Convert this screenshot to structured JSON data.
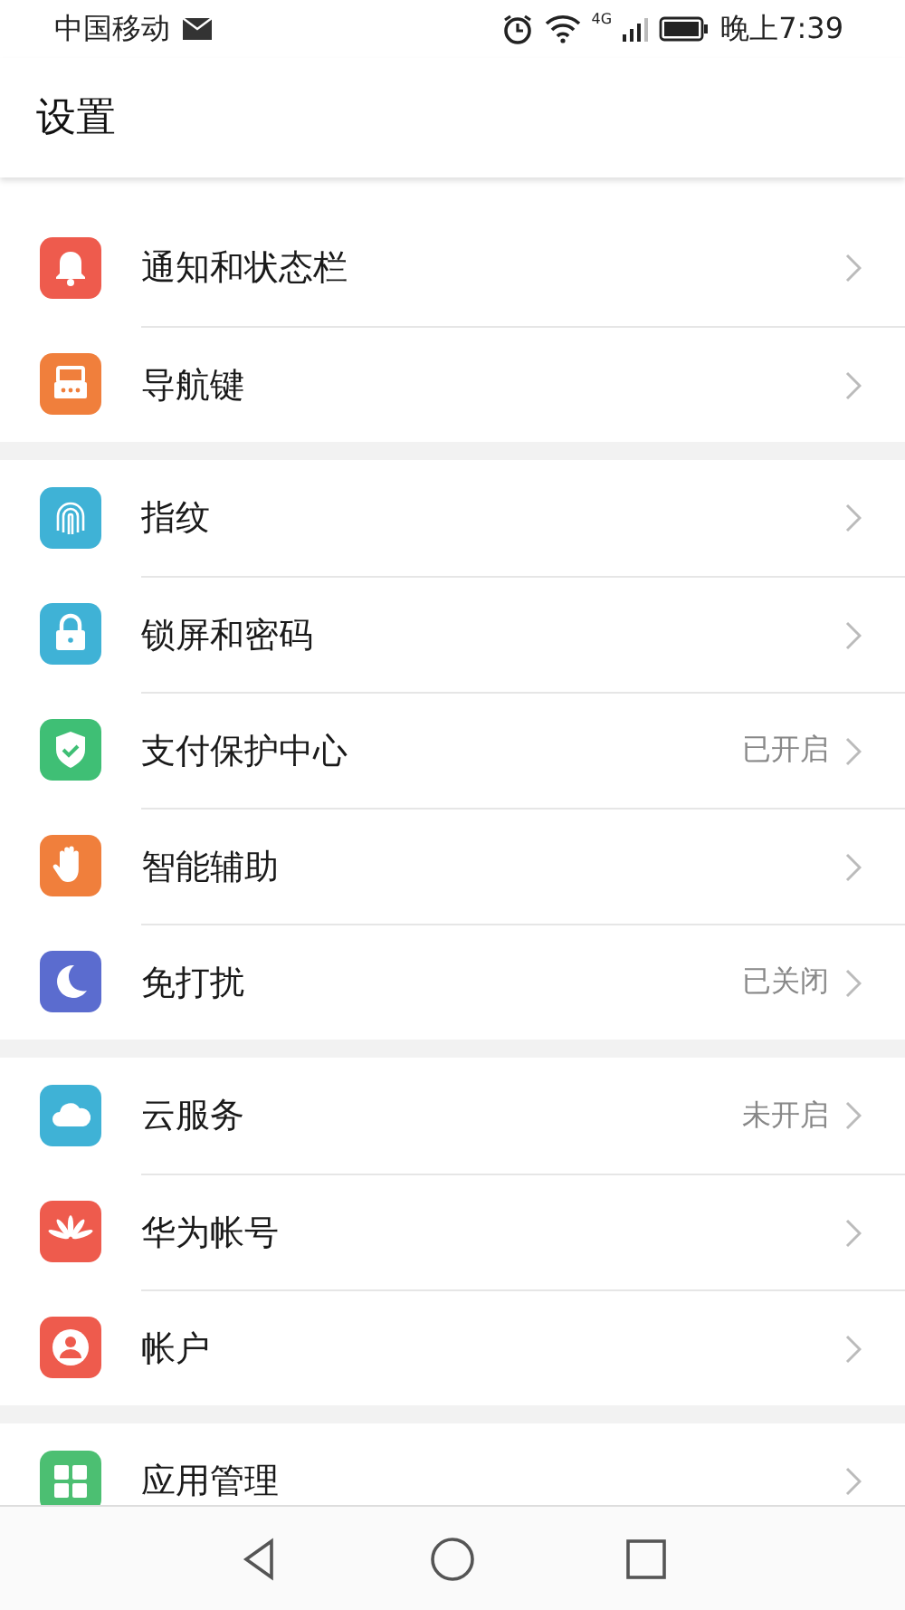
{
  "status_bar": {
    "carrier": "中国移动",
    "time": "晚上7:39",
    "network": "4G"
  },
  "header": {
    "title": "设置"
  },
  "groups": [
    [
      {
        "label": "通知和状态栏"
      },
      {
        "label": "导航键"
      }
    ],
    [
      {
        "label": "指纹"
      },
      {
        "label": "锁屏和密码"
      },
      {
        "label": "支付保护中心",
        "value": "已开启"
      },
      {
        "label": "智能辅助"
      },
      {
        "label": "免打扰",
        "value": "已关闭"
      }
    ],
    [
      {
        "label": "云服务",
        "value": "未开启"
      },
      {
        "label": "华为帐号"
      },
      {
        "label": "帐户"
      }
    ],
    [
      {
        "label": "应用管理"
      }
    ]
  ]
}
